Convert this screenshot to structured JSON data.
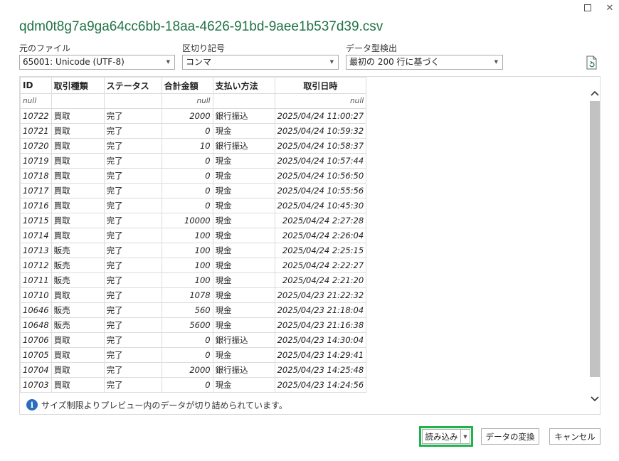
{
  "window": {
    "maximize_icon": "maximize-icon",
    "close_glyph": "✕"
  },
  "title": "qdm0t8g7a9ga64cc6bb-18aa-4626-91bd-9aee1b537d39.csv",
  "options": {
    "file_origin": {
      "label": "元のファイル",
      "value": "65001: Unicode (UTF-8)"
    },
    "delimiter": {
      "label": "区切り記号",
      "value": "コンマ"
    },
    "type_detection": {
      "label": "データ型検出",
      "value": "最初の 200 行に基づく"
    }
  },
  "table": {
    "headers": [
      "ID",
      "取引種類",
      "ステータス",
      "合計金額",
      "支払い方法",
      "取引日時"
    ],
    "null_row": [
      "null",
      "",
      "",
      "null",
      "",
      "null"
    ],
    "rows": [
      [
        "10722",
        "買取",
        "完了",
        "2000",
        "銀行振込",
        "2025/04/24 11:00:27"
      ],
      [
        "10721",
        "買取",
        "完了",
        "0",
        "現金",
        "2025/04/24 10:59:32"
      ],
      [
        "10720",
        "買取",
        "完了",
        "10",
        "銀行振込",
        "2025/04/24 10:58:37"
      ],
      [
        "10719",
        "買取",
        "完了",
        "0",
        "現金",
        "2025/04/24 10:57:44"
      ],
      [
        "10718",
        "買取",
        "完了",
        "0",
        "現金",
        "2025/04/24 10:56:50"
      ],
      [
        "10717",
        "買取",
        "完了",
        "0",
        "現金",
        "2025/04/24 10:55:56"
      ],
      [
        "10716",
        "買取",
        "完了",
        "0",
        "現金",
        "2025/04/24 10:45:30"
      ],
      [
        "10715",
        "買取",
        "完了",
        "10000",
        "現金",
        "2025/04/24 2:27:28"
      ],
      [
        "10714",
        "買取",
        "完了",
        "100",
        "現金",
        "2025/04/24 2:26:04"
      ],
      [
        "10713",
        "販売",
        "完了",
        "100",
        "現金",
        "2025/04/24 2:25:15"
      ],
      [
        "10712",
        "販売",
        "完了",
        "100",
        "現金",
        "2025/04/24 2:22:27"
      ],
      [
        "10711",
        "販売",
        "完了",
        "100",
        "現金",
        "2025/04/24 2:21:20"
      ],
      [
        "10710",
        "買取",
        "完了",
        "1078",
        "現金",
        "2025/04/23 21:22:32"
      ],
      [
        "10646",
        "販売",
        "完了",
        "560",
        "現金",
        "2025/04/23 21:18:04"
      ],
      [
        "10648",
        "販売",
        "完了",
        "5600",
        "現金",
        "2025/04/23 21:16:38"
      ],
      [
        "10706",
        "買取",
        "完了",
        "0",
        "銀行振込",
        "2025/04/23 14:30:04"
      ],
      [
        "10705",
        "買取",
        "完了",
        "0",
        "現金",
        "2025/04/23 14:29:41"
      ],
      [
        "10704",
        "買取",
        "完了",
        "2000",
        "銀行振込",
        "2025/04/23 14:25:48"
      ],
      [
        "10703",
        "買取",
        "完了",
        "0",
        "現金",
        "2025/04/23 14:24:56"
      ]
    ]
  },
  "info_message": "サイズ制限よりプレビュー内のデータが切り詰められています。",
  "buttons": {
    "load": "読み込み",
    "transform": "データの変換",
    "cancel": "キャンセル"
  },
  "colors": {
    "title": "#217346",
    "highlight": "#22b14c",
    "info": "#2a6ebb"
  }
}
